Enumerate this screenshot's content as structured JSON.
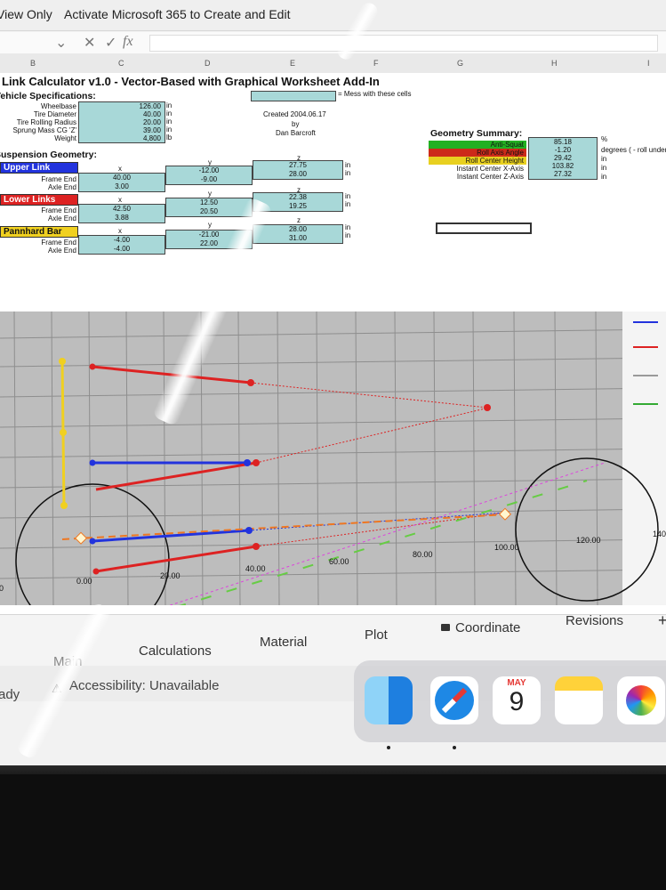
{
  "infobar": {
    "view_only": "View Only",
    "activate": "Activate Microsoft 365 to Create and Edit"
  },
  "formula_bar": {
    "fx": "fx"
  },
  "columns": [
    "B",
    "C",
    "D",
    "E",
    "F",
    "G",
    "H",
    "I"
  ],
  "title": "Link Calculator v1.0  -  Vector-Based with Graphical Worksheet Add-In",
  "mess_note": "= Mess with these cells",
  "created": {
    "line1": "Created 2004.06.17",
    "line2": "by",
    "line3": "Dan Barcroft"
  },
  "vehicle": {
    "heading": "Vehicle Specifications:",
    "rows": [
      {
        "label": "Wheelbase",
        "value": "126.00",
        "unit": "in"
      },
      {
        "label": "Tire Diameter",
        "value": "40.00",
        "unit": "in"
      },
      {
        "label": "Tire Rolling Radius",
        "value": "20.00",
        "unit": "in"
      },
      {
        "label": "Sprung Mass CG 'Z'",
        "value": "39.00",
        "unit": "in"
      },
      {
        "label": "Weight",
        "value": "4,800",
        "unit": "lb"
      }
    ]
  },
  "suspension": {
    "heading": "Suspension Geometry:",
    "upper": {
      "name": "Upper Link",
      "frame_label": "Frame End",
      "axle_label": "Axle End",
      "hx": "x",
      "hy": "y",
      "hz": "z",
      "frame": [
        "40.00",
        "-12.00",
        "27.75"
      ],
      "axle": [
        "3.00",
        "-9.00",
        "28.00"
      ],
      "unit": "in"
    },
    "lower": {
      "name": "Lower Links",
      "frame_label": "Frame End",
      "axle_label": "Axle End",
      "hx": "x",
      "hy": "y",
      "hz": "z",
      "frame": [
        "42.50",
        "12.50",
        "22.38"
      ],
      "axle": [
        "3.88",
        "20.50",
        "19.25"
      ],
      "unit": "in"
    },
    "panhard": {
      "name": "Pannhard Bar",
      "frame_label": "Frame End",
      "axle_label": "Axle End",
      "hx": "x",
      "hy": "y",
      "hz": "z",
      "frame": [
        "-4.00",
        "-21.00",
        "28.00"
      ],
      "axle": [
        "-4.00",
        "22.00",
        "31.00"
      ],
      "unit": "in"
    }
  },
  "summary": {
    "heading": "Geometry Summary:",
    "rows": [
      {
        "label": "Anti-Squat",
        "value": "85.18",
        "unit": "%",
        "color": "#22b022"
      },
      {
        "label": "Roll Axis Angle",
        "value": "-1.20",
        "unit": "degrees ( - roll under",
        "color": "#cc2a1a"
      },
      {
        "label": "Roll Center Height",
        "value": "29.42",
        "unit": "in",
        "color": "#e8d020"
      },
      {
        "label": "Instant Center X-Axis",
        "value": "103.82",
        "unit": "in",
        "color": ""
      },
      {
        "label": "Instant Center Z-Axis",
        "value": "27.32",
        "unit": "in",
        "color": ""
      }
    ]
  },
  "chart_data": {
    "type": "scatter",
    "x_ticks": [
      "0.00",
      "20.00",
      "40.00",
      "60.00",
      "80.00",
      "100.00",
      "120.00",
      "140"
    ],
    "left_tick": "00",
    "legend_colors": [
      "#2233dd",
      "#dd2222",
      "#999999",
      "#33aa33"
    ]
  },
  "tabs": [
    "Main",
    "Calculations",
    "Material",
    "Plot",
    "Coordinate",
    "Revisions"
  ],
  "plus": "+",
  "status": {
    "ready": "ady",
    "accessibility": "Accessibility: Unavailable"
  },
  "dock": {
    "calendar_month": "MAY",
    "calendar_day": "9"
  },
  "colors": {
    "cell_fill": "#a8d8d8",
    "upper": "#2233dd",
    "lower": "#dd2222",
    "panhard": "#f0d020"
  }
}
